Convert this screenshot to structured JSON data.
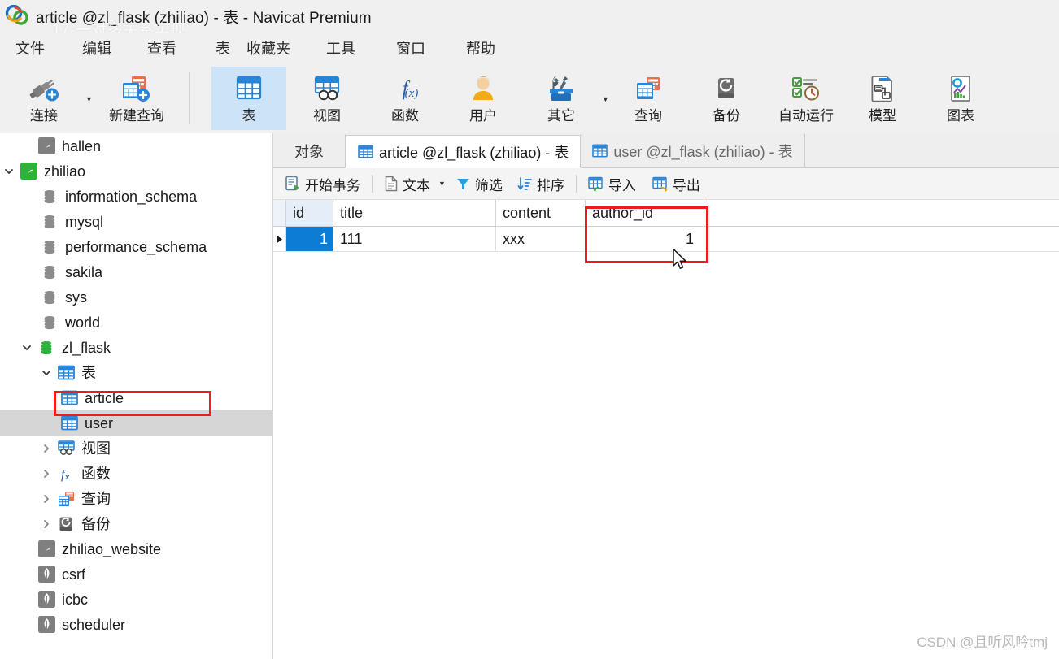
{
  "window": {
    "title": "article @zl_flask (zhiliao) - 表 - Navicat Premium",
    "logo_icon": "navicat-logo-icon",
    "watermark_top": "17-一对多关系实现",
    "watermark_bottom": "CSDN @且听风吟tmj"
  },
  "menubar": {
    "items": [
      {
        "label": "文件",
        "name": "menu-file"
      },
      {
        "label": "编辑",
        "name": "menu-edit"
      },
      {
        "label": "查看",
        "name": "menu-view"
      },
      {
        "label": "表",
        "name": "menu-table"
      },
      {
        "label": "收藏夹",
        "name": "menu-favorites"
      },
      {
        "label": "工具",
        "name": "menu-tools"
      },
      {
        "label": "窗口",
        "name": "menu-window"
      },
      {
        "label": "帮助",
        "name": "menu-help"
      }
    ]
  },
  "ribbon": {
    "buttons": [
      {
        "label": "连接",
        "icon": "connection-plug-icon",
        "selected": false
      },
      {
        "label": "新建查询",
        "icon": "new-query-icon",
        "selected": false
      },
      {
        "label": "表",
        "icon": "table-grid-icon",
        "selected": true
      },
      {
        "label": "视图",
        "icon": "view-icon",
        "selected": false
      },
      {
        "label": "函数",
        "icon": "function-fx-icon",
        "selected": false
      },
      {
        "label": "用户",
        "icon": "user-person-icon",
        "selected": false
      },
      {
        "label": "其它",
        "icon": "others-toolbox-icon",
        "selected": false
      },
      {
        "label": "查询",
        "icon": "query-icon",
        "selected": false
      },
      {
        "label": "备份",
        "icon": "backup-icon",
        "selected": false
      },
      {
        "label": "自动运行",
        "icon": "automation-icon",
        "selected": false
      },
      {
        "label": "模型",
        "icon": "model-icon",
        "selected": false
      },
      {
        "label": "图表",
        "icon": "chart-icon",
        "selected": false
      }
    ]
  },
  "sidebar": {
    "tree": [
      {
        "label": "hallen",
        "icon": "mysql-connection-gray-icon",
        "depth": 1,
        "twisty": "",
        "selected": false
      },
      {
        "label": "zhiliao",
        "icon": "mysql-connection-green-icon",
        "depth": 0,
        "twisty": "down",
        "selected": false
      },
      {
        "label": "information_schema",
        "icon": "database-gray-icon",
        "depth": 2,
        "twisty": "",
        "selected": false
      },
      {
        "label": "mysql",
        "icon": "database-gray-icon",
        "depth": 2,
        "twisty": "",
        "selected": false
      },
      {
        "label": "performance_schema",
        "icon": "database-gray-icon",
        "depth": 2,
        "twisty": "",
        "selected": false
      },
      {
        "label": "sakila",
        "icon": "database-gray-icon",
        "depth": 2,
        "twisty": "",
        "selected": false
      },
      {
        "label": "sys",
        "icon": "database-gray-icon",
        "depth": 2,
        "twisty": "",
        "selected": false
      },
      {
        "label": "world",
        "icon": "database-gray-icon",
        "depth": 2,
        "twisty": "",
        "selected": false
      },
      {
        "label": "zl_flask",
        "icon": "database-green-icon",
        "depth": 1,
        "twisty": "down",
        "selected": false
      },
      {
        "label": "表",
        "icon": "table-folder-icon",
        "depth": 2,
        "twisty": "down",
        "selected": false
      },
      {
        "label": "article",
        "icon": "table-grid-icon",
        "depth": 3,
        "twisty": "",
        "selected": false
      },
      {
        "label": "user",
        "icon": "table-grid-icon",
        "depth": 3,
        "twisty": "",
        "selected": true
      },
      {
        "label": "视图",
        "icon": "view-folder-icon",
        "depth": 2,
        "twisty": "right",
        "selected": false
      },
      {
        "label": "函数",
        "icon": "function-fx-icon",
        "depth": 2,
        "twisty": "right",
        "selected": false
      },
      {
        "label": "查询",
        "icon": "query-folder-icon",
        "depth": 2,
        "twisty": "right",
        "selected": false
      },
      {
        "label": "备份",
        "icon": "backup-folder-icon",
        "depth": 2,
        "twisty": "right",
        "selected": false
      },
      {
        "label": "zhiliao_website",
        "icon": "mysql-connection-gray-icon",
        "depth": 1,
        "twisty": "",
        "selected": false
      },
      {
        "label": "csrf",
        "icon": "mongodb-leaf-icon",
        "depth": 1,
        "twisty": "",
        "selected": false
      },
      {
        "label": "icbc",
        "icon": "mongodb-leaf-icon",
        "depth": 1,
        "twisty": "",
        "selected": false
      },
      {
        "label": "scheduler",
        "icon": "mongodb-leaf-icon",
        "depth": 1,
        "twisty": "",
        "selected": false
      }
    ]
  },
  "tabs": [
    {
      "label": "对象",
      "icon": "",
      "active": false,
      "name": "tab-objects"
    },
    {
      "label": "article @zl_flask (zhiliao) - 表",
      "icon": "table-grid-icon",
      "active": true,
      "name": "tab-article-table"
    },
    {
      "label": "user @zl_flask (zhiliao) - 表",
      "icon": "table-grid-icon",
      "active": false,
      "name": "tab-user-table"
    }
  ],
  "gridbar": {
    "buttons": [
      {
        "label": "开始事务",
        "icon": "begin-transaction-icon",
        "name": "begin-transaction-button"
      },
      {
        "label": "文本",
        "icon": "text-document-icon",
        "name": "text-button",
        "caret": true
      },
      {
        "label": "筛选",
        "icon": "filter-funnel-icon",
        "name": "filter-button"
      },
      {
        "label": "排序",
        "icon": "sort-icon",
        "name": "sort-button"
      },
      {
        "label": "导入",
        "icon": "import-icon",
        "name": "import-button"
      },
      {
        "label": "导出",
        "icon": "export-icon",
        "name": "export-button"
      }
    ]
  },
  "grid": {
    "columns": [
      "id",
      "title",
      "content",
      "author_id"
    ],
    "rows": [
      {
        "id": "1",
        "title": "111",
        "content": "xxx",
        "author_id": "1"
      }
    ],
    "selected_cell": "id",
    "row_indicator": "▶"
  },
  "annotations": {
    "colors": {
      "highlight_box": "#ee1c1c",
      "selection_blue": "#0c7cd5",
      "ribbon_selected": "#cde3f7"
    },
    "boxes": [
      {
        "name": "article-tree-highlight",
        "target": "article"
      },
      {
        "name": "author-id-column-highlight",
        "target": "author_id"
      }
    ]
  }
}
